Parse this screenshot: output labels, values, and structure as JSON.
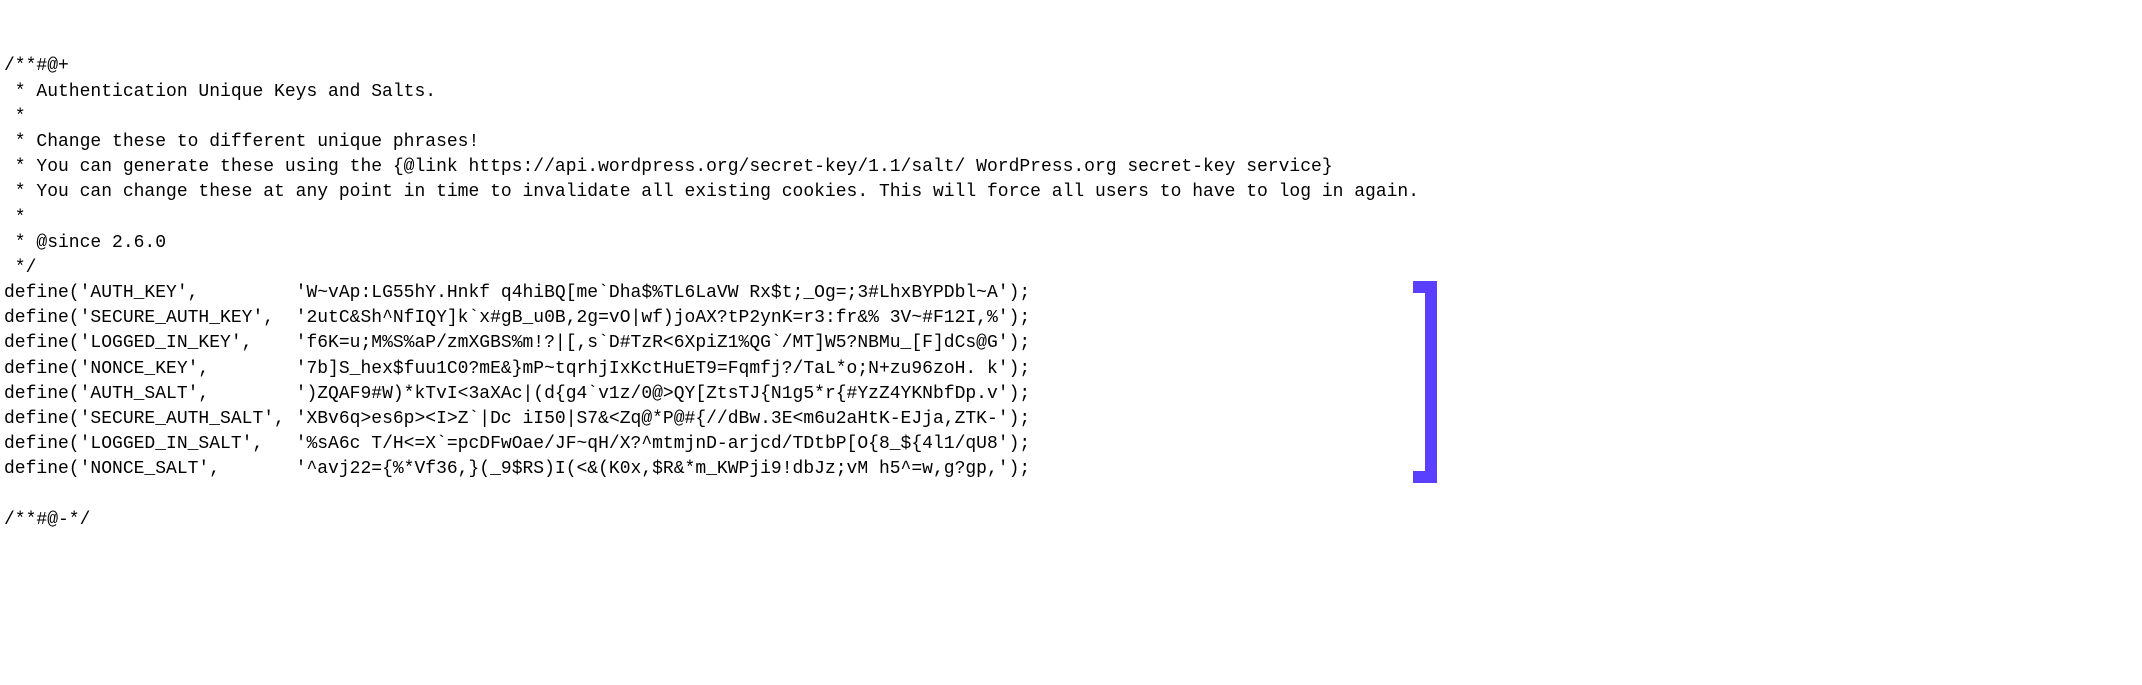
{
  "comment": {
    "l1": "/**#@+",
    "l2": " * Authentication Unique Keys and Salts.",
    "l3": " *",
    "l4": " * Change these to different unique phrases!",
    "l5": " * You can generate these using the {@link https://api.wordpress.org/secret-key/1.1/salt/ WordPress.org secret-key service}",
    "l6": " * You can change these at any point in time to invalidate all existing cookies. This will force all users to have to log in again.",
    "l7": " *",
    "l8": " * @since 2.6.0",
    "l9": " */"
  },
  "defines": [
    {
      "key": "define('AUTH_KEY',         ",
      "val": "'W~vAp:LG55hY.Hnkf q4hiBQ[me`Dha$%TL6LaVW Rx$t;_Og=;3#LhxBYPDbl~A');"
    },
    {
      "key": "define('SECURE_AUTH_KEY',  ",
      "val": "'2utC&Sh^NfIQY]k`x#gB_u0B,2g=vO|wf)joAX?tP2ynK=r3:fr&% 3V~#F12I,%');"
    },
    {
      "key": "define('LOGGED_IN_KEY',    ",
      "val": "'f6K=u;M%S%aP/zmXGBS%m!?|[,s`D#TzR<6XpiZ1%QG`/MT]W5?NBMu_[F]dCs@G');"
    },
    {
      "key": "define('NONCE_KEY',        ",
      "val": "'7b]S_hex$fuu1C0?mE&}mP~tqrhjIxKctHuET9=Fqmfj?/TaL*o;N+zu96zoH. k');"
    },
    {
      "key": "define('AUTH_SALT',        ",
      "val": "')ZQAF9#W)*kTvI<3aXAc|(d{g4`v1z/0@>QY[ZtsTJ{N1g5*r{#YzZ4YKNbfDp.v');"
    },
    {
      "key": "define('SECURE_AUTH_SALT', ",
      "val": "'XBv6q>es6p><I>Z`|Dc iI50|S7&<Zq@*P@#{//dBw.3E<m6u2aHtK-EJja,ZTK-');"
    },
    {
      "key": "define('LOGGED_IN_SALT',   ",
      "val": "'%sA6c T/H<=X`=pcDFwOae/JF~qH/X?^mtmjnD-arjcd/TDtbP[O{8_${4l1/qU8');"
    },
    {
      "key": "define('NONCE_SALT',       ",
      "val": "'^avj22={%*Vf36,}(_9$RS)I(<&(K0x,$R&*m_KWPji9!dbJz;vM h5^=w,g?gp,');"
    }
  ],
  "footer": "/**#@-*/"
}
